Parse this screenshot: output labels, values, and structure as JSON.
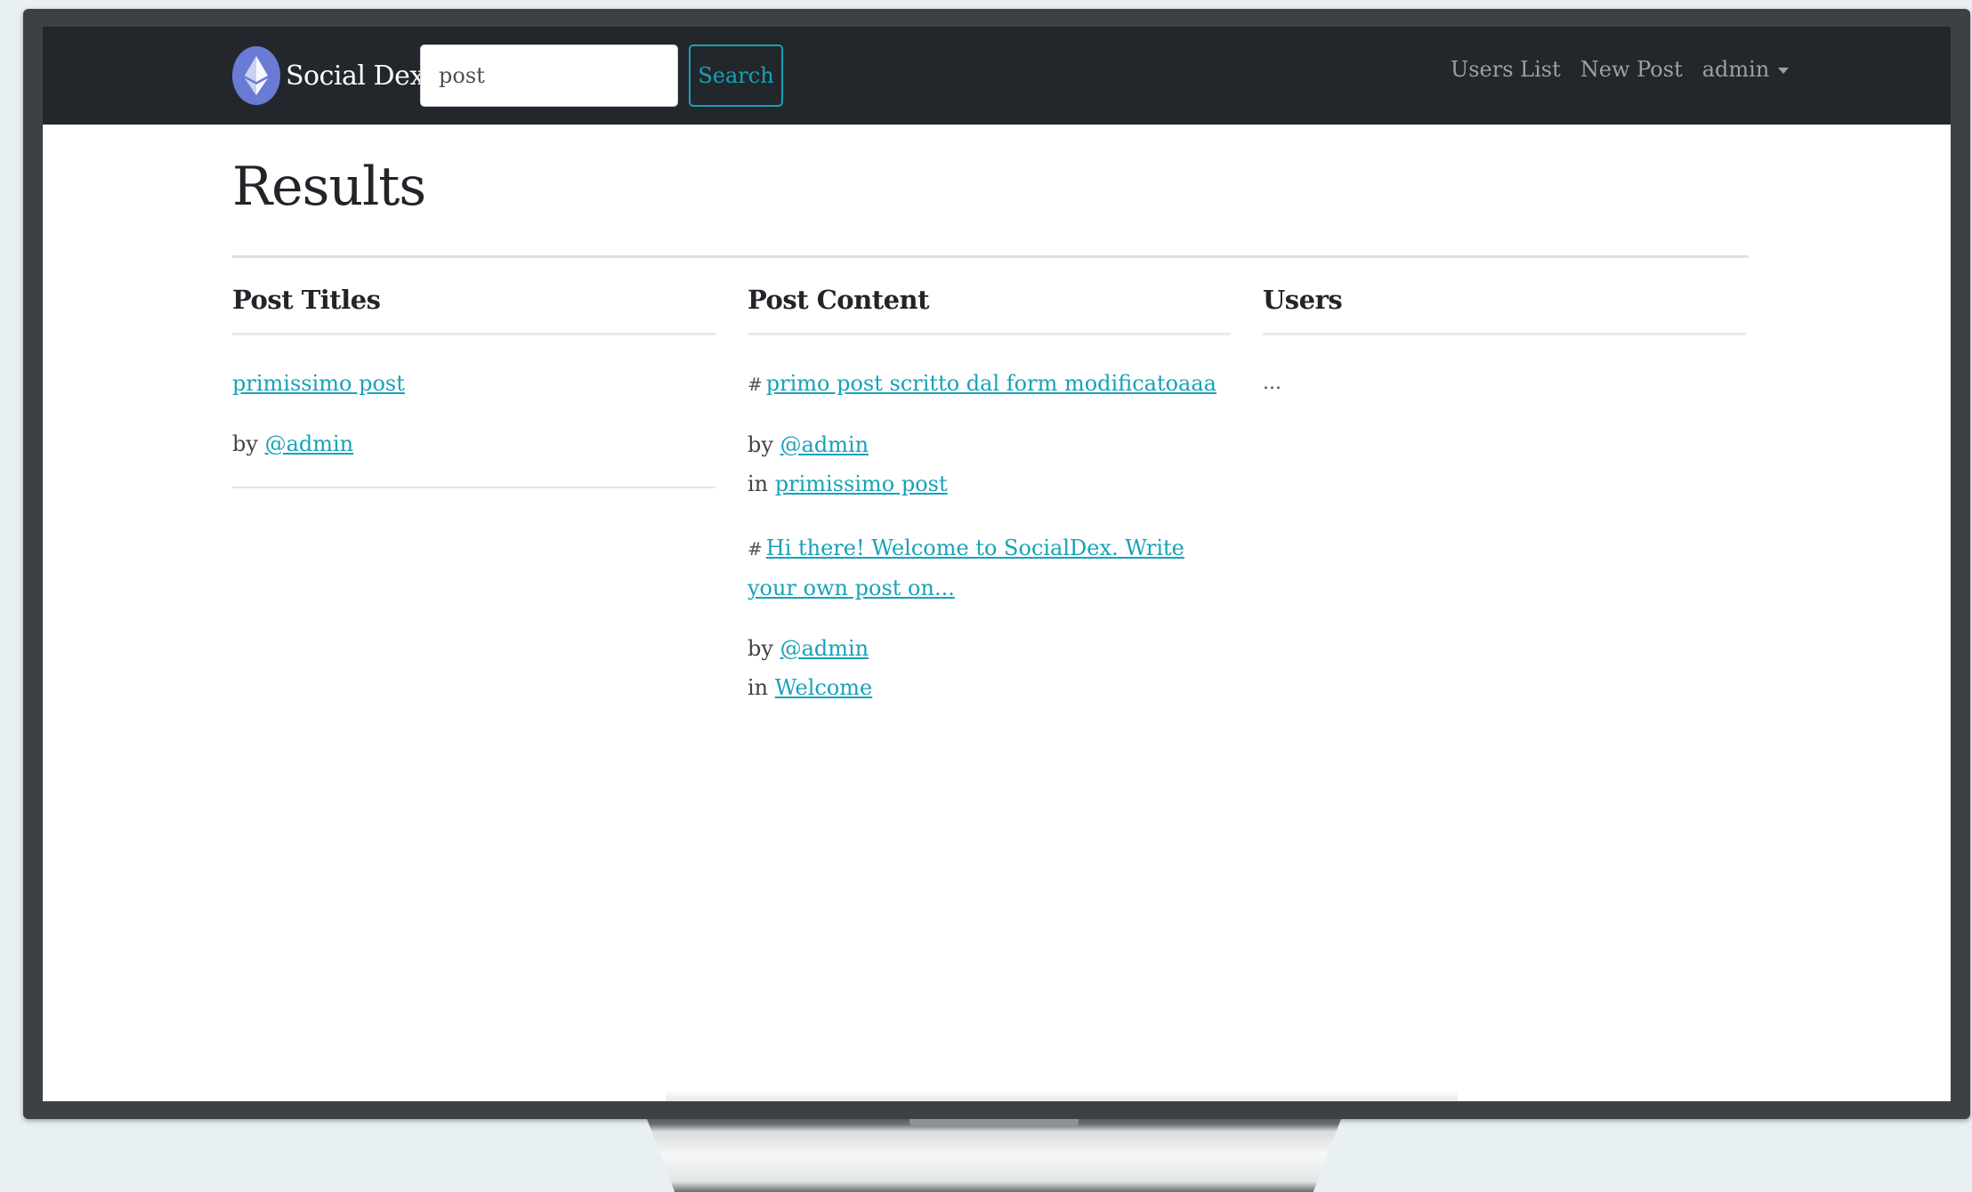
{
  "navbar": {
    "brand_name": "Social Dex",
    "search": {
      "value": "post",
      "button_label": "Search"
    },
    "links": {
      "users_list": "Users List",
      "new_post": "New Post",
      "admin": "admin"
    }
  },
  "page": {
    "title": "Results"
  },
  "columns": {
    "post_titles": {
      "heading": "Post Titles",
      "items": [
        {
          "title": "primissimo post",
          "by_label": "by",
          "author": "@admin"
        }
      ]
    },
    "post_content": {
      "heading": "Post Content",
      "items": [
        {
          "hash": "#",
          "content": "primo post scritto dal form modificatoaaa",
          "by_label": "by",
          "author": "@admin",
          "in_label": "in",
          "post": "primissimo post"
        },
        {
          "hash": "#",
          "content": "Hi there! Welcome to SocialDex. Write your own post on...",
          "by_label": "by",
          "author": "@admin",
          "in_label": "in",
          "post": "Welcome"
        }
      ]
    },
    "users": {
      "heading": "Users",
      "empty_text": "..."
    }
  },
  "colors": {
    "navbar_bg": "#23272b",
    "accent": "#17a2b8",
    "brand_logo": "#6a7bd6"
  },
  "icons": {
    "brand": "ethereum-logo-icon",
    "dropdown": "caret-down-icon"
  }
}
